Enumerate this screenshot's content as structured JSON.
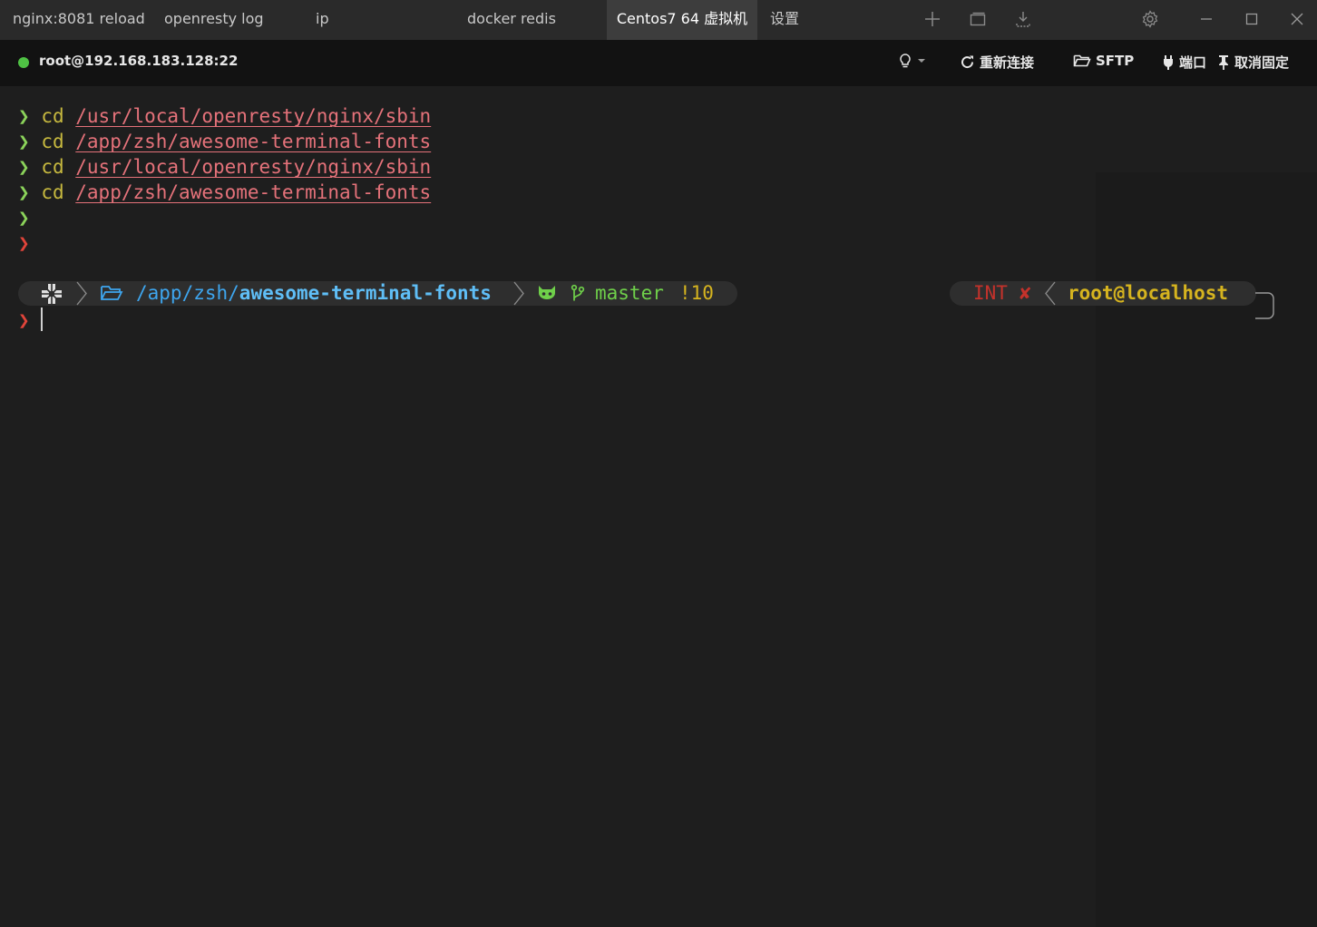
{
  "tabs": [
    {
      "label": "nginx:8081 reload",
      "active": false
    },
    {
      "label": "openresty log",
      "active": false
    },
    {
      "label": "ip",
      "active": false
    },
    {
      "label": "docker redis",
      "active": false
    },
    {
      "label": "Centos7 64 虚拟机",
      "active": true
    },
    {
      "label": "设置",
      "active": false
    }
  ],
  "toolbar": {
    "host": "root@192.168.183.128:22",
    "reconnect_label": "重新连接",
    "sftp_label": "SFTP",
    "port_label": "端口",
    "unpin_label": "取消固定"
  },
  "terminal": {
    "history": [
      {
        "cmd": "cd",
        "path": "/usr/local/openresty/nginx/sbin"
      },
      {
        "cmd": "cd",
        "path": "/app/zsh/awesome-terminal-fonts"
      },
      {
        "cmd": "cd",
        "path": "/usr/local/openresty/nginx/sbin"
      },
      {
        "cmd": "cd",
        "path": "/app/zsh/awesome-terminal-fonts"
      }
    ],
    "prompt_char": "❯",
    "prompt": {
      "path_prefix": "/app/zsh/",
      "path_dir": "awesome-terminal-fonts",
      "git_branch": "master",
      "git_status": "!10",
      "exit_status": "INT",
      "exit_mark": "✘",
      "user_host": "root@localhost"
    }
  },
  "colors": {
    "accent_green": "#8bd35a",
    "prompt_red": "#e0443a",
    "path_pink": "#e5727a",
    "command_yellow": "#c7b93f",
    "dir_blue": "#3ea6ef",
    "host_yellow": "#d6b41f"
  }
}
